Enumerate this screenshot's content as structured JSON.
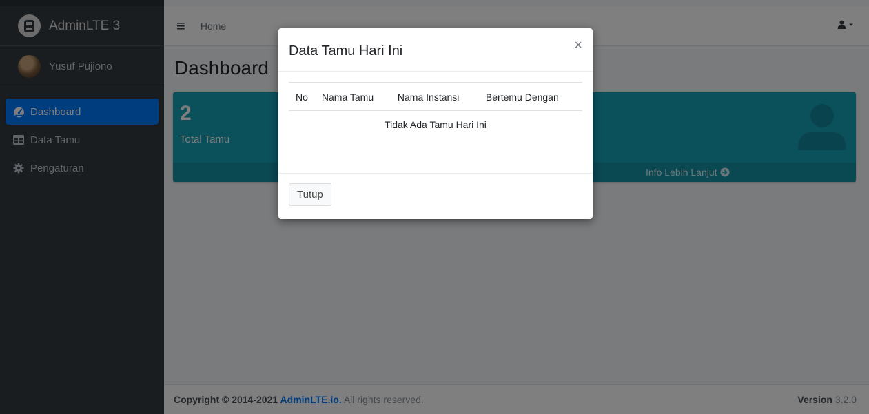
{
  "sidebar": {
    "brand": "AdminLTE 3",
    "user_name": "Yusuf Pujiono",
    "items": [
      {
        "label": "Dashboard",
        "icon": "tachometer-icon",
        "active": true
      },
      {
        "label": "Data Tamu",
        "icon": "table-icon",
        "active": false
      },
      {
        "label": "Pengaturan",
        "icon": "gear-icon",
        "active": false
      }
    ]
  },
  "topbar": {
    "home": "Home",
    "menu_icon": "hamburger-icon",
    "user_icon": "user-icon"
  },
  "content": {
    "title": "Dashboard",
    "stat_box": {
      "value": "2",
      "label": "Total Tamu",
      "footer_link": "Info Lebih Lanjut",
      "color": "#17a2b8"
    }
  },
  "footer": {
    "copyright": "Copyright © 2014-2021 ",
    "brand_link": "AdminLTE.io.",
    "rights": " All rights reserved.",
    "version_label": "Version",
    "version_value": " 3.2.0"
  },
  "modal": {
    "title": "Data Tamu Hari Ini",
    "close_glyph": "×",
    "columns": [
      "No",
      "Nama Tamu",
      "Nama Instansi",
      "Bertemu Dengan"
    ],
    "empty_message": "Tidak Ada Tamu Hari Ini",
    "close_button": "Tutup"
  }
}
